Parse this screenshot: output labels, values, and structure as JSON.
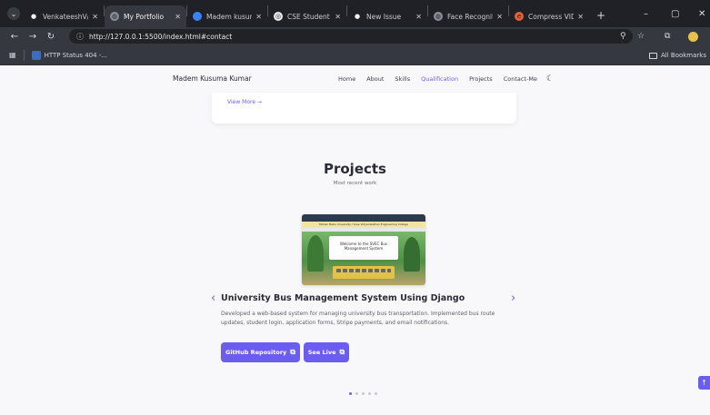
{
  "browser": {
    "tabs": [
      {
        "label": "VenkateeshV/Portf",
        "icon": "github-icon",
        "active": false
      },
      {
        "label": "My Portfolio",
        "icon": "globe-icon",
        "active": true
      },
      {
        "label": "Madem kusuma k",
        "icon": "site-icon",
        "active": false
      },
      {
        "label": "CSE Student Profi",
        "icon": "chrome-icon",
        "active": false
      },
      {
        "label": "New Issue",
        "icon": "github-icon",
        "active": false
      },
      {
        "label": "Face Recognition",
        "icon": "globe-icon",
        "active": false
      },
      {
        "label": "Compress VIDEO",
        "icon": "compress-icon",
        "active": false
      }
    ],
    "url": "http://127.0.0.1:5500/index.html#contact",
    "bookmarks": [
      {
        "label": "HTTP Status 404 -..."
      }
    ],
    "all_bookmarks_label": "All Bookmarks"
  },
  "site": {
    "brand": "Madem Kusuma Kumar",
    "nav": [
      "Home",
      "About",
      "Skills",
      "Qualification",
      "Projects",
      "Contact-Me"
    ],
    "active_nav": "Qualification"
  },
  "qualification": {
    "view_more": "View More →"
  },
  "projects": {
    "title": "Projects",
    "subtitle": "Most recent work",
    "screenshot": {
      "banner": "Mohan Babu University / Sree Vidyanikethan Engineering College",
      "panel_title": "Welcome to the SVEC Bus Management System"
    },
    "current": {
      "title": "University Bus Management System Using Django",
      "description": "Developed a web-based system for managing university bus transportation. Implemented bus route updates, student login, application forms, Stripe payments, and email notifications.",
      "github_label": "GitHub Repository",
      "live_label": "See Live"
    },
    "pagination": {
      "count": 5,
      "active": 1
    }
  },
  "colors": {
    "accent": "#6a5df0",
    "text": "#2b2b36",
    "page_bg": "#f8f8fb"
  }
}
